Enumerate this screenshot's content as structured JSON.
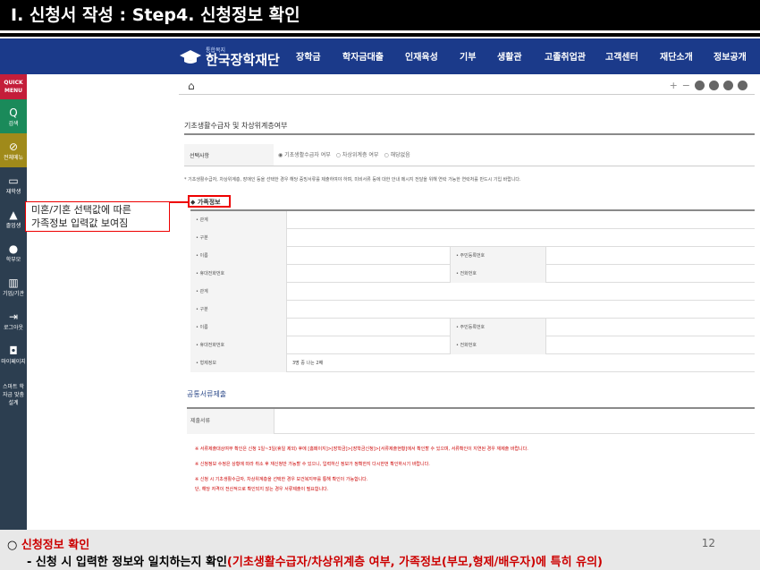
{
  "slide": {
    "title": "Ⅰ. 신청서 작성 : Step4. 신청정보 확인",
    "page_number": "12",
    "footer_bullet": "○",
    "footer_heading": "신청정보 확인",
    "footer_dash": "- 신청 시 입력한 정보와 일치하는지 확인",
    "footer_highlight": "(기초생활수급자/차상위계층 여부, 가족정보(부모,형제/배우자)에 특히 유의)",
    "callout_line1": "미혼/기혼 선택값에 따른",
    "callout_line2": "가족정보 입력값 보여짐"
  },
  "site": {
    "logo_sub": "통합복지",
    "logo_main": "한국장학재단",
    "nav": [
      "장학금",
      "학자금대출",
      "인재육성",
      "기부",
      "생활관",
      "고졸취업관",
      "고객센터",
      "재단소개",
      "정보공개"
    ]
  },
  "quick_menu": {
    "head_line1": "QUICK",
    "head_line2": "MENU",
    "items": [
      {
        "icon": "Q",
        "label": "검색"
      },
      {
        "icon": "⊘",
        "label": "전체메뉴"
      },
      {
        "icon": "▭",
        "label": "재학생"
      },
      {
        "icon": "▲",
        "label": "졸업생"
      },
      {
        "icon": "●",
        "label": "학부모"
      },
      {
        "icon": "▥",
        "label": "기업/기관"
      },
      {
        "icon": "⇥",
        "label": "로그아웃"
      },
      {
        "icon": "◘",
        "label": "마이페이지"
      },
      {
        "icon": "",
        "label": "스마트 학자금 맞춤설계"
      }
    ]
  },
  "toolbar": {
    "home_icon": "⌂",
    "plus": "+",
    "minus": "−"
  },
  "form": {
    "section1_title": "기초생활수급자 및 차상위계층여부",
    "select_label": "선택사항",
    "options": [
      "◉ 기초생활수급자 여부",
      "○ 차상위계층 여부",
      "○ 해당없음"
    ],
    "note": "* 기초생활수급자, 차상위계층, 장애인 등을 선택한 경우 해당 증빙서류를 제출하여야 하며, 미비서류 등에 대한 안내 메시지 전달을 위해 연락 가능한 연락처를 반드시 기입 바랍니다.",
    "family_head": "◆ 가족정보",
    "rows": [
      {
        "l": "• 관계",
        "r": "",
        "v": ""
      },
      {
        "l": "• 구분",
        "r": "",
        "v": ""
      },
      {
        "l": "• 이름",
        "r": "• 주민등록번호",
        "v": ""
      },
      {
        "l": "• 휴대전화번호",
        "r": "• 전화번호",
        "v": ""
      },
      {
        "l": "• 관계",
        "r": "",
        "v": ""
      },
      {
        "l": "• 구분",
        "r": "",
        "v": ""
      },
      {
        "l": "• 이름",
        "r": "• 주민등록번호",
        "v": ""
      },
      {
        "l": "• 휴대전화번호",
        "r": "• 전화번호",
        "v": ""
      },
      {
        "l": "• 형제정보",
        "r": "",
        "v": "3명 중 나는 2째"
      }
    ],
    "docs_title": "공통서류제출",
    "docs_label": "제출서류",
    "warnings": [
      "※ 서류제출대상여부 확인은 신청 1일~3일(휴일 제외) 후에 [홈페이지]>[장학금]>[장학금신청]>[서류제출현황]에서 확인할 수 있으며, 서류확인이 지연된 경우 재제출 바랍니다.",
      "※ 신청정보 수정은 상황에 따라 취소 후 재신청만 가능할 수 있으니, 입력하신 정보가 정확한지 다시한번 확인하시기 바랍니다.",
      "※ 신청 시 기초생활수급자, 차상위계층을 선택한 경우 보건복지부를 통해 확인이 가능합니다.",
      "   단, 해당 자격이 전산적으로 확인되지 않는 경우 서류제출이 필요합니다."
    ]
  }
}
